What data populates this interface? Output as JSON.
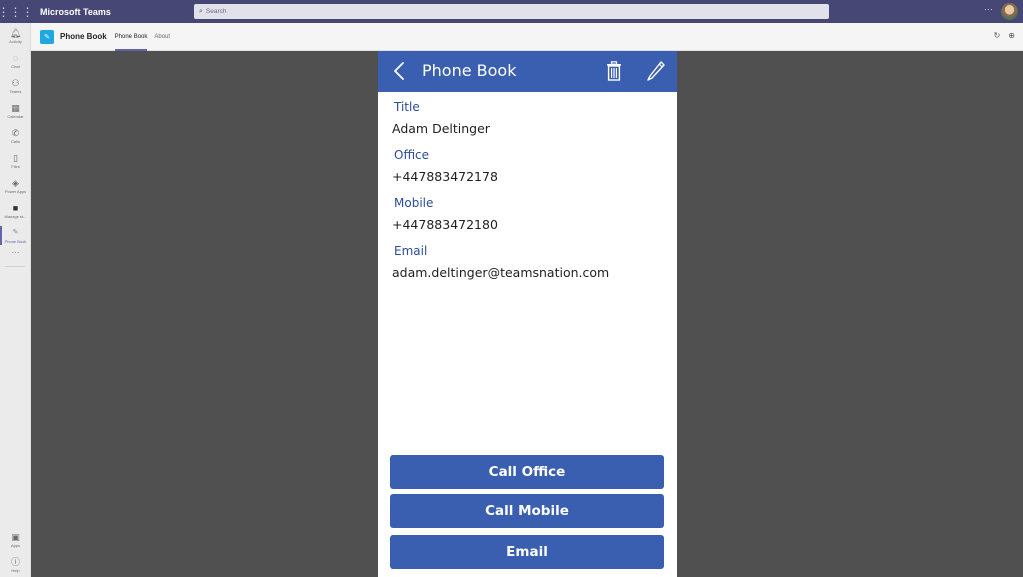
{
  "teams": {
    "app_title": "Microsoft Teams",
    "search_placeholder": "Search",
    "more_label": "···"
  },
  "rail": {
    "items": [
      {
        "label": "Activity",
        "icon": "bell-icon"
      },
      {
        "label": "Chat",
        "icon": "chat-icon"
      },
      {
        "label": "Teams",
        "icon": "teams-icon"
      },
      {
        "label": "Calendar",
        "icon": "calendar-icon"
      },
      {
        "label": "Calls",
        "icon": "phone-icon"
      },
      {
        "label": "Files",
        "icon": "file-icon"
      },
      {
        "label": "Power Apps",
        "icon": "power-apps-icon"
      },
      {
        "label": "Manage st...",
        "icon": "manage-icon"
      },
      {
        "label": "Phone Book",
        "icon": "pencil-icon"
      }
    ],
    "more": "···",
    "bottom": [
      {
        "label": "Apps",
        "icon": "apps-icon"
      },
      {
        "label": "Help",
        "icon": "help-icon"
      }
    ]
  },
  "app_header": {
    "name": "Phone Book",
    "tabs": [
      "Phone Book",
      "About"
    ]
  },
  "phone_book": {
    "header_title": "Phone Book",
    "fields": [
      {
        "label": "Title",
        "value": "Adam Deltinger"
      },
      {
        "label": "Office",
        "value": "+447883472178"
      },
      {
        "label": "Mobile",
        "value": "+447883472180"
      },
      {
        "label": "Email",
        "value": "adam.deltinger@teamsnation.com"
      }
    ],
    "buttons": {
      "call_office": "Call Office",
      "call_mobile": "Call Mobile",
      "email": "Email"
    }
  },
  "colors": {
    "teams_bar": "#464775",
    "accent": "#6264a7",
    "app_blue": "#3a5fb0",
    "label_blue": "#2c4b99",
    "backdrop": "#505050"
  }
}
